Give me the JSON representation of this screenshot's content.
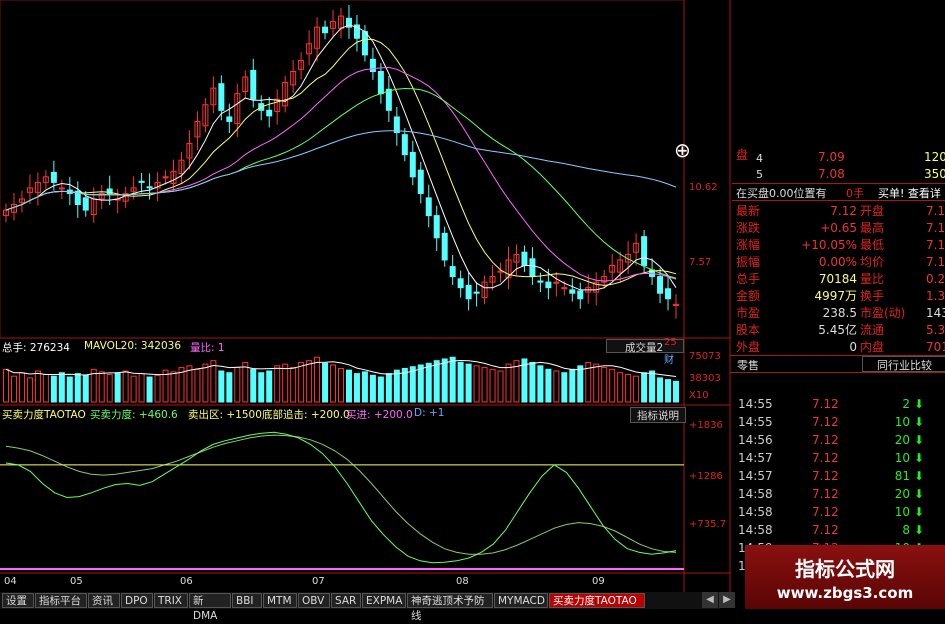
{
  "header": {
    "vol_label": "总手: 276234",
    "mavol_label": "MAVOL20: 342036",
    "ratio_label": "量比: 1",
    "vol_dropdown": "成交量2",
    "ind_label": "买卖力度TAOTAO",
    "ind_mm": "买卖力度: +460.6",
    "ind_sell": "卖出区: +1500",
    "ind_bottom": "底部追击: +200.0",
    "ind_buy": "买进: +200.0",
    "ind_d": "D: +1",
    "ind_button": "指标说明"
  },
  "right_axis": {
    "price_hi": "10.62",
    "price_lo": "7.57",
    "misc_25": "25",
    "misc_cai": "财",
    "vol_hi": "75073",
    "vol_mid": "38303",
    "vol_unit": "X10",
    "ind_hi": "+1836",
    "ind_mid": "+1286",
    "ind_lo": "+735.7"
  },
  "x_axis": [
    "04",
    "05",
    "06",
    "07",
    "08",
    "09"
  ],
  "order_book": {
    "row4_label": "盘",
    "row4_level": "4",
    "row4_price": "7.09",
    "row4_qty": "120",
    "row5_level": "5",
    "row5_price": "7.08",
    "row5_qty": "350",
    "buy_note": "在买盘0.00位置有",
    "buy_note2": "0手",
    "buy_note3": "买单! 查看详",
    "plus": "⊕"
  },
  "quote": [
    {
      "k": "最新",
      "v": "7.12",
      "k2": "开盘",
      "v2": "7.1"
    },
    {
      "k": "涨跌",
      "v": "+0.65",
      "k2": "最高",
      "v2": "7.1"
    },
    {
      "k": "涨幅",
      "v": "+10.05%",
      "k2": "最低",
      "v2": "7.1"
    },
    {
      "k": "振幅",
      "v": "0.00%",
      "k2": "均价",
      "v2": "7.1"
    },
    {
      "k": "总手",
      "v": "70184",
      "k2": "量比",
      "v2": "0.2"
    },
    {
      "k": "金额",
      "v": "4997万",
      "k2": "换手",
      "v2": "1.31"
    },
    {
      "k": "市盈",
      "v": "238.5",
      "k2": "市盈(动)",
      "v2": "143"
    },
    {
      "k": "股本",
      "v": "5.45亿",
      "k2": "流通",
      "v2": "5.38("
    },
    {
      "k": "外盘",
      "v": "0",
      "k2": "内盘",
      "v2": "7018"
    }
  ],
  "ticks_header": {
    "left": "零售",
    "right": "同行业比较"
  },
  "ticks": [
    {
      "t": "14:55",
      "p": "7.12",
      "q": "2"
    },
    {
      "t": "14:55",
      "p": "7.12",
      "q": "10"
    },
    {
      "t": "14:56",
      "p": "7.12",
      "q": "20"
    },
    {
      "t": "14:57",
      "p": "7.12",
      "q": "10"
    },
    {
      "t": "14:57",
      "p": "7.12",
      "q": "81"
    },
    {
      "t": "14:58",
      "p": "7.12",
      "q": "20"
    },
    {
      "t": "14:58",
      "p": "7.12",
      "q": "10"
    },
    {
      "t": "14:58",
      "p": "7.12",
      "q": "8"
    },
    {
      "t": "14:59",
      "p": "7.12",
      "q": "10"
    },
    {
      "t": "15:00",
      "p": "7.12",
      "q": ""
    }
  ],
  "tabs": [
    "设置",
    "指标平台",
    "资讯",
    "DPO",
    "TRIX",
    "新DMA",
    "BBI",
    "MTM",
    "OBV",
    "SAR",
    "EXPMA",
    "神奇逃顶术予防线",
    "MYMACD",
    "买卖力度TAOTAO"
  ],
  "watermark": {
    "title": "指标公式网",
    "url": "www.zbgs3.com"
  },
  "colors": {
    "up": "#ff3232",
    "down": "#54ffff",
    "ma5": "#ffffff",
    "ma10": "#ffff66",
    "ma20": "#ff66ff",
    "ma30": "#66ff66",
    "ma60": "#88ccff",
    "axis": "#cc2222"
  },
  "chart_data": [
    {
      "type": "candlestick",
      "title": "",
      "x_ticks": [
        "04",
        "05",
        "06",
        "07",
        "08",
        "09"
      ],
      "y_ticks": [
        "10.62",
        "7.57"
      ],
      "ylim": [
        7.0,
        12.9
      ],
      "close": [
        9.2,
        9.3,
        9.4,
        9.6,
        9.7,
        9.8,
        9.7,
        9.6,
        9.5,
        9.3,
        9.2,
        9.4,
        9.5,
        9.5,
        9.4,
        9.5,
        9.6,
        9.7,
        9.6,
        9.7,
        9.8,
        9.9,
        10.1,
        10.4,
        10.8,
        11.1,
        11.4,
        11.0,
        10.8,
        11.3,
        11.6,
        11.2,
        11.0,
        10.9,
        11.2,
        11.5,
        11.7,
        11.9,
        12.2,
        12.5,
        12.4,
        12.6,
        12.7,
        12.5,
        12.3,
        12.0,
        11.7,
        11.3,
        11.0,
        10.6,
        10.2,
        9.8,
        9.5,
        9.1,
        8.7,
        8.3,
        8.0,
        7.8,
        7.6,
        7.7,
        7.9,
        8.0,
        8.1,
        8.3,
        8.4,
        8.2,
        8.0,
        7.9,
        7.8,
        7.9,
        7.8,
        7.7,
        7.6,
        7.8,
        7.9,
        8.0,
        8.2,
        8.3,
        8.4,
        8.6,
        8.2,
        8.0,
        7.7,
        7.6,
        7.5
      ],
      "ma5_note": "moving averages drawn from close",
      "series": [
        {
          "name": "MA5"
        },
        {
          "name": "MA10"
        },
        {
          "name": "MA20"
        },
        {
          "name": "MA30"
        },
        {
          "name": "MA60"
        }
      ]
    },
    {
      "type": "bar",
      "title": "成交量2",
      "y_ticks": [
        "75073",
        "38303"
      ],
      "ylim": [
        0,
        75073
      ],
      "values": [
        38,
        30,
        34,
        28,
        36,
        32,
        30,
        34,
        29,
        33,
        31,
        38,
        35,
        32,
        34,
        36,
        30,
        33,
        29,
        31,
        37,
        35,
        40,
        42,
        38,
        44,
        48,
        36,
        34,
        40,
        46,
        38,
        34,
        36,
        42,
        44,
        40,
        46,
        48,
        52,
        45,
        43,
        39,
        37,
        33,
        35,
        31,
        29,
        33,
        37,
        39,
        41,
        43,
        45,
        48,
        50,
        52,
        46,
        44,
        42,
        40,
        38,
        36,
        44,
        48,
        50,
        46,
        42,
        38,
        36,
        34,
        38,
        42,
        46,
        44,
        40,
        38,
        34,
        32,
        30,
        34,
        36,
        28,
        26,
        24
      ]
    },
    {
      "type": "line",
      "title": "买卖力度TAOTAO",
      "y_ticks": [
        "+1836",
        "+1286",
        "+735.7"
      ],
      "ylim": [
        350,
        1950
      ],
      "levels": {
        "sell": 1500,
        "bottom": 200,
        "buy": 200
      },
      "series": [
        {
          "name": "买卖力度",
          "values": [
            1520,
            1500,
            1430,
            1300,
            1200,
            1150,
            1160,
            1200,
            1250,
            1290,
            1300,
            1280,
            1320,
            1400,
            1480,
            1560,
            1650,
            1720,
            1760,
            1790,
            1820,
            1840,
            1850,
            1830,
            1790,
            1720,
            1620,
            1480,
            1300,
            1100,
            900,
            750,
            620,
            520,
            470,
            450,
            455,
            470,
            500,
            560,
            650,
            800,
            1000,
            1200,
            1380,
            1500,
            1420,
            1250,
            1050,
            850,
            700,
            600,
            560,
            540,
            555,
            580
          ]
        },
        {
          "name": "D",
          "values": [
            1700,
            1680,
            1650,
            1600,
            1540,
            1480,
            1430,
            1400,
            1390,
            1400,
            1420,
            1440,
            1460,
            1500,
            1540,
            1590,
            1640,
            1690,
            1730,
            1760,
            1790,
            1810,
            1820,
            1815,
            1800,
            1770,
            1720,
            1650,
            1560,
            1440,
            1300,
            1150,
            1000,
            870,
            760,
            670,
            600,
            560,
            540,
            540,
            555,
            590,
            640,
            700,
            760,
            820,
            860,
            880,
            870,
            840,
            790,
            720,
            650,
            600,
            570,
            560
          ]
        }
      ]
    }
  ]
}
